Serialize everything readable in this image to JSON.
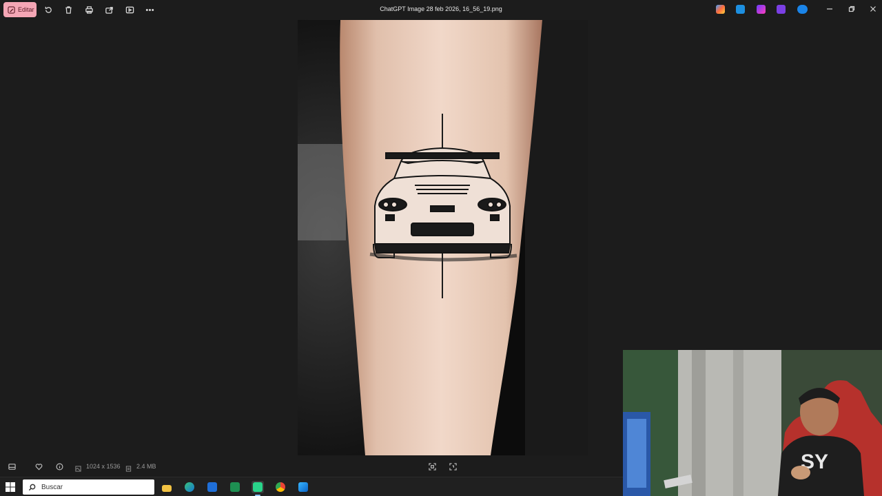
{
  "toolbar": {
    "edit_label": "Editar",
    "title": "ChatGPT Image 28 feb 2026, 16_56_19.png",
    "accent": "#f4a6b5"
  },
  "status": {
    "dimensions": "1024 x 1536",
    "file_size": "2.4 MB"
  },
  "taskbar": {
    "search_placeholder": "Buscar",
    "apps": [
      "file-explorer-icon",
      "edge-icon",
      "store-icon",
      "excel-icon",
      "app-icon",
      "chrome-icon",
      "photos-icon"
    ]
  }
}
